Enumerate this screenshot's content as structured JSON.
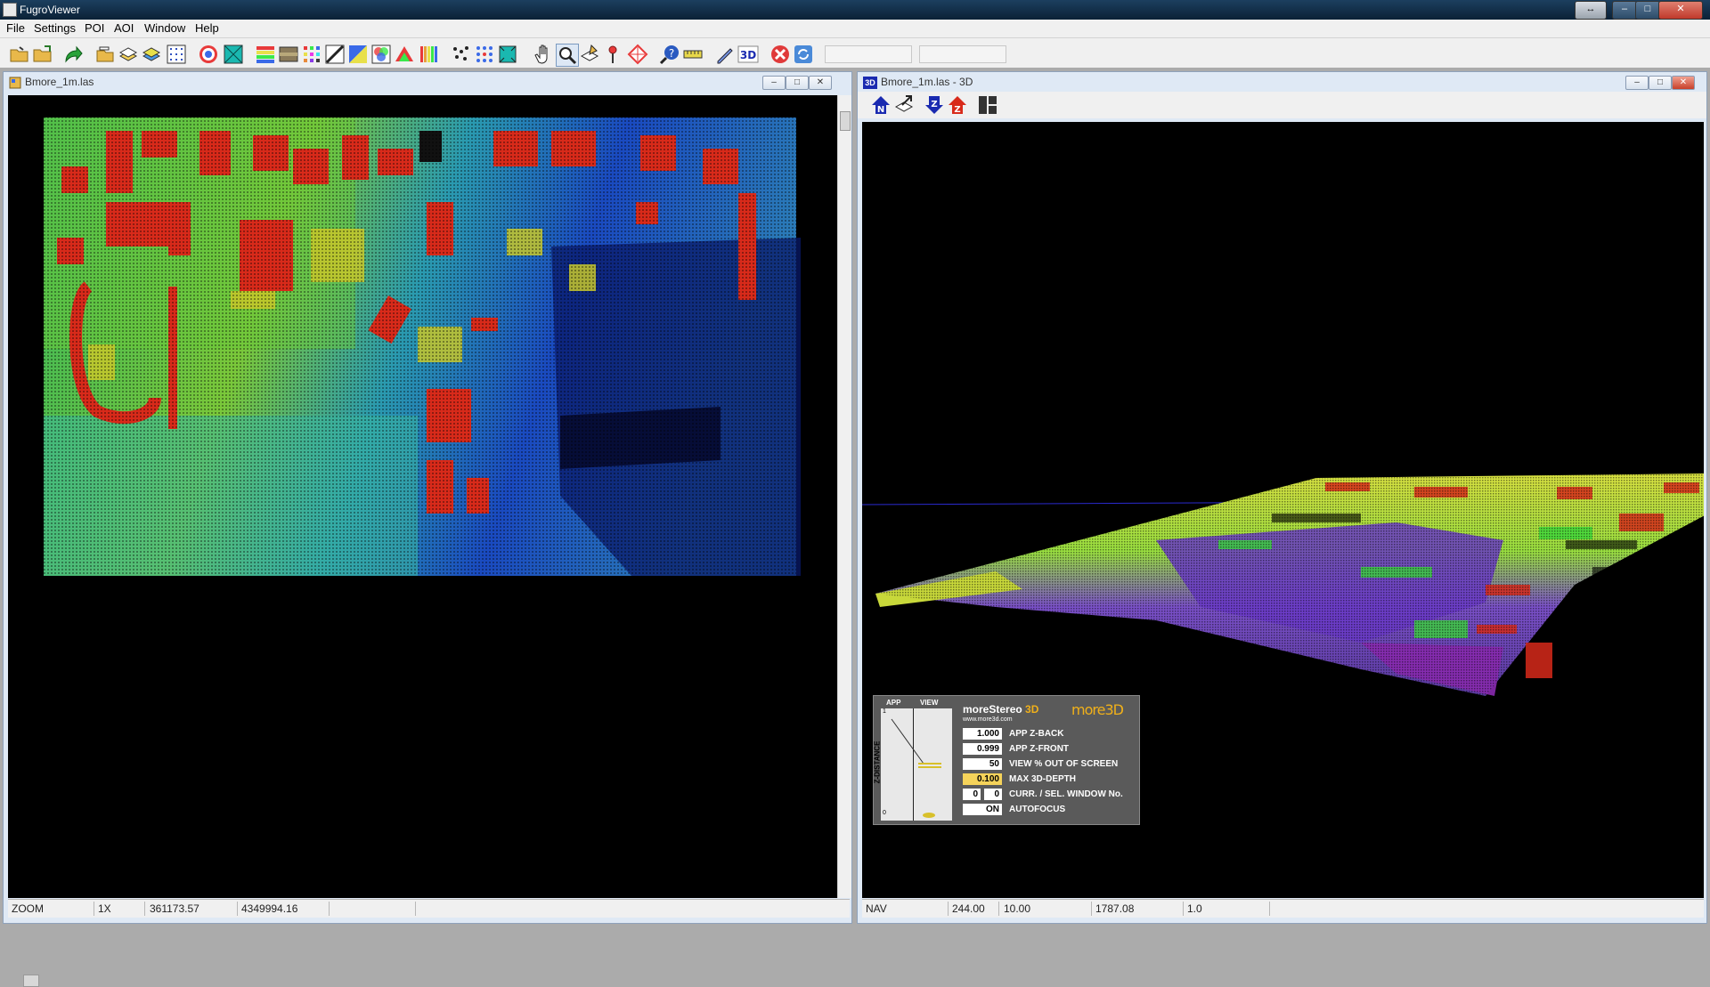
{
  "app": {
    "title": "FugroViewer"
  },
  "menu": [
    "File",
    "Settings",
    "POI",
    "AOI",
    "Window",
    "Help"
  ],
  "toolbar_icons": [
    "open-file-icon",
    "open-folder-icon",
    "export-arrow-icon",
    "layers-open-icon",
    "layers-stack-icon",
    "layers-color-icon",
    "grid-points-icon",
    "target-icon",
    "tin-surface-icon",
    "color-ramp-icon",
    "intensity-icon",
    "palette-icon",
    "slope-icon",
    "classification-icon",
    "rgb-icon",
    "elevation-spectrum-icon",
    "scatter-points-icon",
    "point-grid-icon",
    "surface-icon",
    "pan-hand-icon",
    "zoom-icon",
    "profile-icon",
    "pin-icon",
    "crosshair-icon",
    "query-info-icon",
    "ruler-icon",
    "measure-pencil-icon",
    "3d-view-icon",
    "close-red-icon",
    "refresh-icon"
  ],
  "left_window": {
    "title": "Bmore_1m.las",
    "status": {
      "mode": "ZOOM",
      "zoom": "1X",
      "x": "361173.57",
      "y": "4349994.16"
    }
  },
  "right_window": {
    "title": "Bmore_1m.las - 3D",
    "icon_label": "3D",
    "toolbar_icons": [
      "north-icon",
      "export-view-icon",
      "z-down-icon",
      "z-up-icon",
      "layout-icon"
    ],
    "status": {
      "mode": "NAV",
      "v1": "244.00",
      "v2": "10.00",
      "v3": "1787.08",
      "v4": "1.0"
    },
    "stereo_panel": {
      "brand": "moreStereo",
      "brand_suffix": "3D",
      "url": "www.more3d.com",
      "logo": "more3D",
      "col_app": "APP",
      "col_view": "VIEW",
      "axis_label": "Z-DISTANCE",
      "axis_top": "1",
      "axis_bottom": "0",
      "rows": [
        {
          "value": "1.000",
          "label": "APP Z-BACK"
        },
        {
          "value": "0.999",
          "label": "APP Z-FRONT"
        },
        {
          "value": "50",
          "label": "VIEW % OUT OF SCREEN"
        },
        {
          "value": "0.100",
          "label": "MAX 3D-DEPTH"
        },
        {
          "value": "0",
          "value2": "0",
          "label": "CURR. / SEL. WINDOW No."
        },
        {
          "value": "ON",
          "label": "AUTOFOCUS"
        }
      ]
    }
  }
}
